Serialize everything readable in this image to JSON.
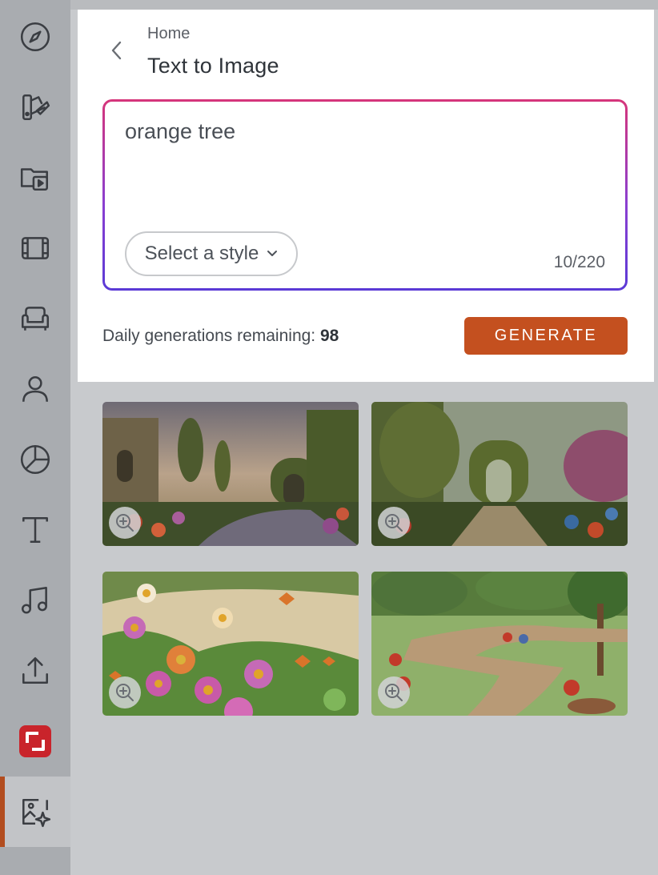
{
  "sidebar": {
    "items": [
      {
        "icon": "compass-icon"
      },
      {
        "icon": "palette-brush-icon"
      },
      {
        "icon": "video-folder-icon"
      },
      {
        "icon": "film-icon"
      },
      {
        "icon": "armchair-icon"
      },
      {
        "icon": "person-icon"
      },
      {
        "icon": "pie-chart-icon"
      },
      {
        "icon": "text-icon"
      },
      {
        "icon": "music-note-icon"
      },
      {
        "icon": "upload-icon"
      },
      {
        "icon": "brand-logo-icon"
      },
      {
        "icon": "ai-image-icon",
        "active": true
      }
    ],
    "accent_color": "#b24d1f"
  },
  "header": {
    "breadcrumb": "Home",
    "title": "Text to Image"
  },
  "prompt": {
    "value": "orange tree",
    "style_select_label": "Select a style",
    "char_count": "10/220"
  },
  "footer": {
    "remaining_label": "Daily generations remaining:",
    "remaining_value": "98",
    "generate_label": "GENERATE",
    "generate_color": "#c4501f"
  },
  "gallery": {
    "images": [
      {
        "name": "garden-archway-castle"
      },
      {
        "name": "garden-stone-arch-path"
      },
      {
        "name": "daisies-butterflies-dragonflies"
      },
      {
        "name": "park-brick-path-flowers"
      }
    ]
  }
}
